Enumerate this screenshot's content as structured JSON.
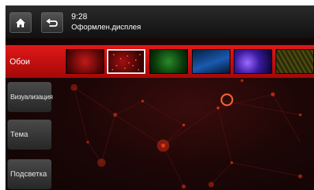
{
  "header": {
    "time": "9:28",
    "title": "Оформлен.дисплея",
    "home_icon": "home-icon",
    "back_icon": "back-arrow-icon"
  },
  "sidebar": {
    "items": [
      {
        "label": "Обои",
        "active": true
      },
      {
        "label": "Визуализация",
        "active": false
      },
      {
        "label": "Тема",
        "active": false
      },
      {
        "label": "Подсветка",
        "active": false
      }
    ]
  },
  "wallpapers": [
    {
      "name": "red-glow",
      "selected": false
    },
    {
      "name": "red-particles",
      "selected": true
    },
    {
      "name": "green-cells",
      "selected": false
    },
    {
      "name": "blue-waves",
      "selected": false
    },
    {
      "name": "purple-light",
      "selected": false
    },
    {
      "name": "yellow-hex",
      "selected": false
    }
  ],
  "colors": {
    "accent": "#d41010",
    "header_bg": "#1a1a1a"
  }
}
